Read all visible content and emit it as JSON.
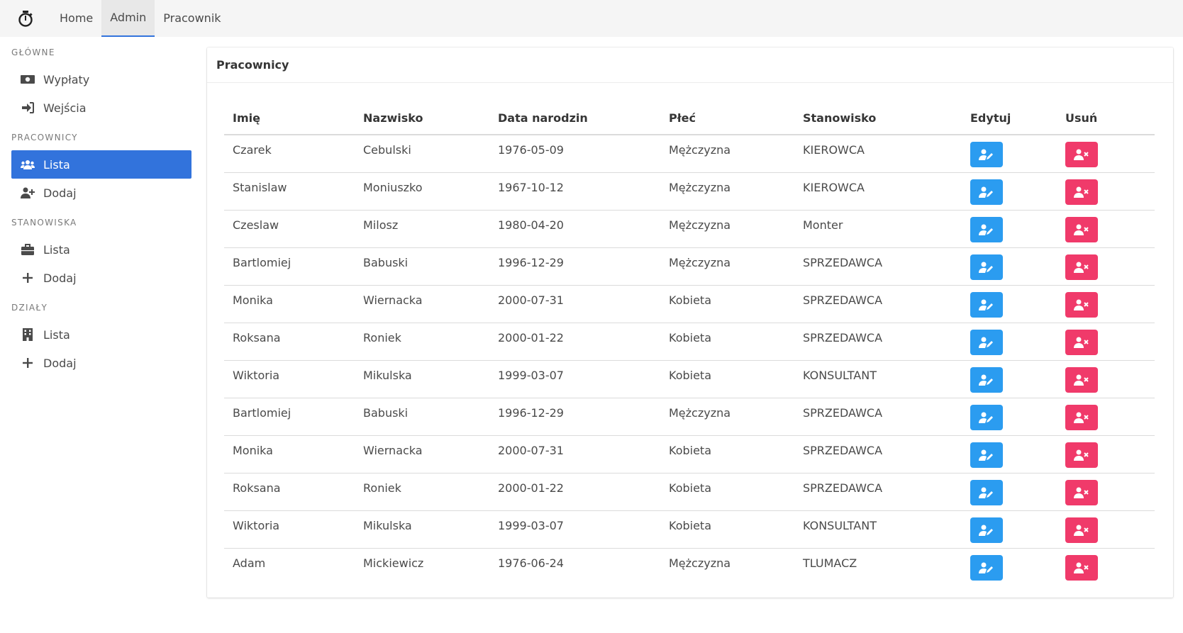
{
  "navbar": {
    "logo_icon": "stopwatch-icon",
    "items": [
      {
        "label": "Home",
        "active": false
      },
      {
        "label": "Admin",
        "active": true
      },
      {
        "label": "Pracownik",
        "active": false
      }
    ]
  },
  "sidebar": {
    "sections": [
      {
        "label": "GŁÓWNE",
        "items": [
          {
            "label": "Wypłaty",
            "icon": "money-icon"
          },
          {
            "label": "Wejścia",
            "icon": "sign-in-icon"
          }
        ]
      },
      {
        "label": "PRACOWNICY",
        "items": [
          {
            "label": "Lista",
            "icon": "users-icon",
            "active": true
          },
          {
            "label": "Dodaj",
            "icon": "user-plus-icon"
          }
        ]
      },
      {
        "label": "STANOWISKA",
        "items": [
          {
            "label": "Lista",
            "icon": "briefcase-icon"
          },
          {
            "label": "Dodaj",
            "icon": "plus-icon"
          }
        ]
      },
      {
        "label": "DZIAŁY",
        "items": [
          {
            "label": "Lista",
            "icon": "building-icon"
          },
          {
            "label": "Dodaj",
            "icon": "plus-icon"
          }
        ]
      }
    ]
  },
  "card": {
    "title": "Pracownicy",
    "columns": [
      "Imię",
      "Nazwisko",
      "Data narodzin",
      "Płeć",
      "Stanowisko",
      "Edytuj",
      "Usuń"
    ],
    "rows": [
      [
        "Czarek",
        "Cebulski",
        "1976-05-09",
        "Mężczyzna",
        "KIEROWCA"
      ],
      [
        "Stanislaw",
        "Moniuszko",
        "1967-10-12",
        "Mężczyzna",
        "KIEROWCA"
      ],
      [
        "Czeslaw",
        "Milosz",
        "1980-04-20",
        "Mężczyzna",
        "Monter"
      ],
      [
        "Bartlomiej",
        "Babuski",
        "1996-12-29",
        "Mężczyzna",
        "SPRZEDAWCA"
      ],
      [
        "Monika",
        "Wiernacka",
        "2000-07-31",
        "Kobieta",
        "SPRZEDAWCA"
      ],
      [
        "Roksana",
        "Roniek",
        "2000-01-22",
        "Kobieta",
        "SPRZEDAWCA"
      ],
      [
        "Wiktoria",
        "Mikulska",
        "1999-03-07",
        "Kobieta",
        "KONSULTANT"
      ],
      [
        "Bartlomiej",
        "Babuski",
        "1996-12-29",
        "Mężczyzna",
        "SPRZEDAWCA"
      ],
      [
        "Monika",
        "Wiernacka",
        "2000-07-31",
        "Kobieta",
        "SPRZEDAWCA"
      ],
      [
        "Roksana",
        "Roniek",
        "2000-01-22",
        "Kobieta",
        "SPRZEDAWCA"
      ],
      [
        "Wiktoria",
        "Mikulska",
        "1999-03-07",
        "Kobieta",
        "KONSULTANT"
      ],
      [
        "Adam",
        "Mickiewicz",
        "1976-06-24",
        "Mężczyzna",
        "TLUMACZ"
      ]
    ],
    "edit_icon": "user-edit-icon",
    "delete_icon": "user-remove-icon"
  },
  "colors": {
    "accent": "#3273dc",
    "edit_button": "#2b9cf0",
    "delete_button": "#f03a6a",
    "navbar_bg": "#f5f5f5"
  }
}
